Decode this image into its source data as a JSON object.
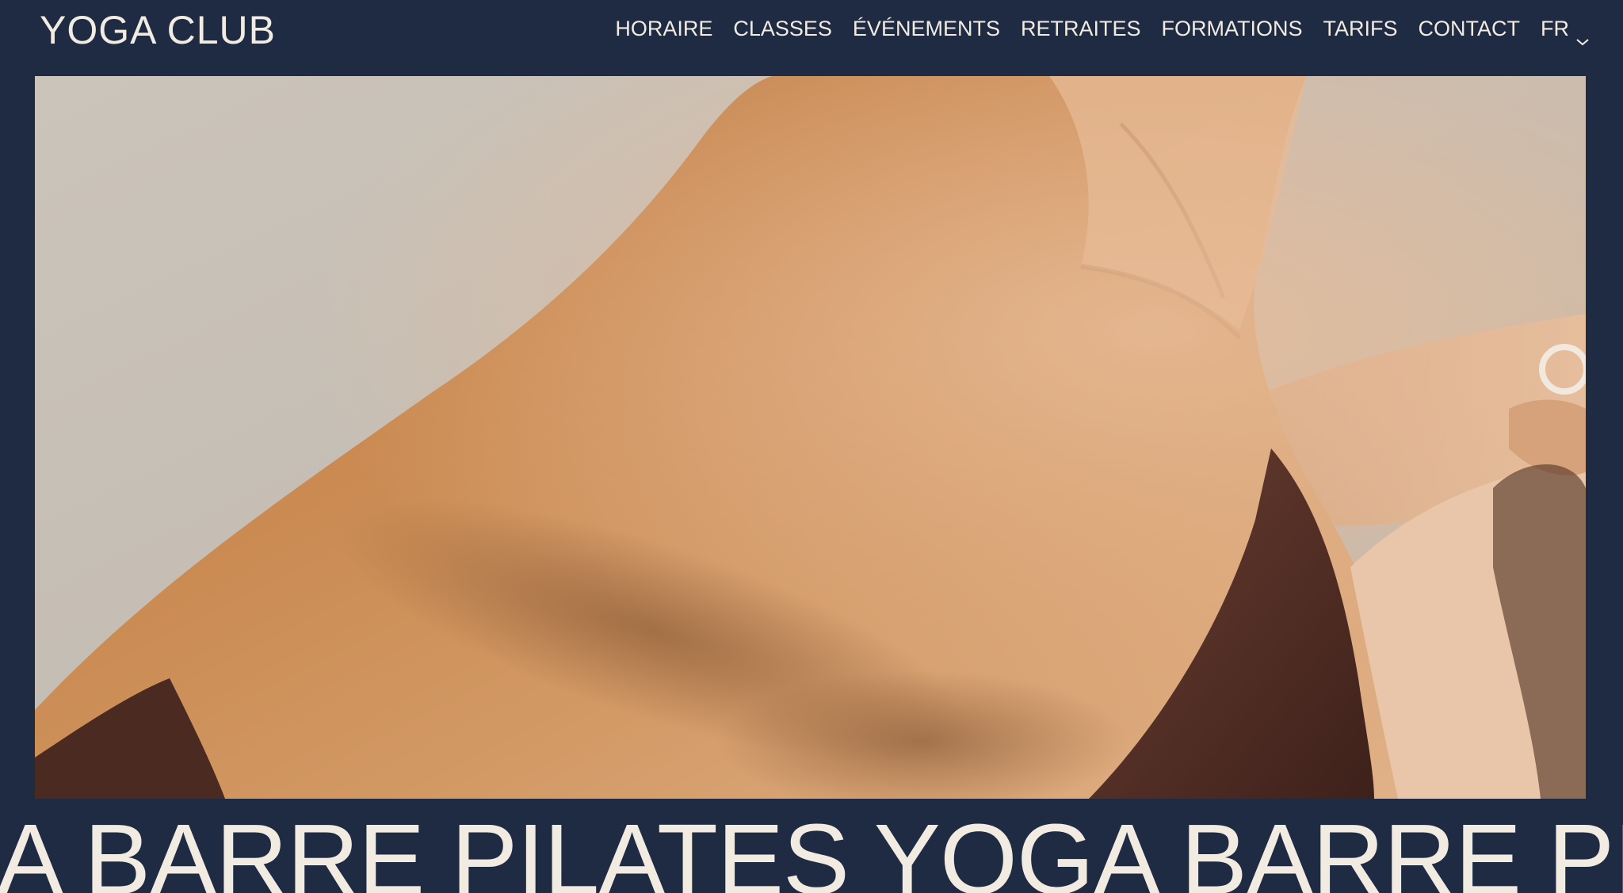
{
  "brand": {
    "logo": "YOGA CLUB"
  },
  "nav": {
    "items": [
      "HORAIRE",
      "CLASSES",
      "ÉVÉNEMENTS",
      "RETRAITES",
      "FORMATIONS",
      "TARIFS",
      "CONTACT"
    ],
    "language": "FR"
  },
  "hero": {
    "image_alt": "Close-up of a person's neck and shoulder during a yoga stretch"
  },
  "marquee": {
    "text": "A BARRE PILATES YOGA BARRE PILATES Y"
  },
  "colors": {
    "background": "#1f2b43",
    "text": "#f1ebe2"
  }
}
